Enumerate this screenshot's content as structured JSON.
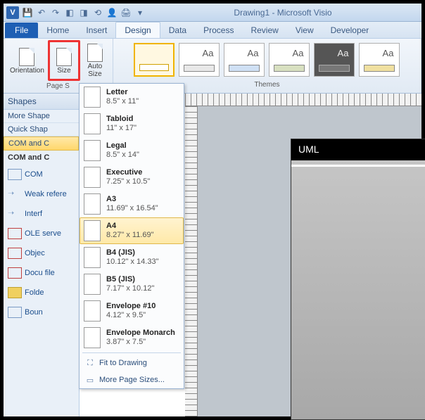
{
  "title": "Drawing1  - Microsoft Visio",
  "tabs": {
    "file": "File",
    "home": "Home",
    "insert": "Insert",
    "design": "Design",
    "data": "Data",
    "process": "Process",
    "review": "Review",
    "view": "View",
    "developer": "Developer"
  },
  "ribbon": {
    "orientation": "Orientation",
    "size": "Size",
    "autosize": "Auto\nSize",
    "page_setup": "Page S",
    "themes": "Themes",
    "theme_swatches": [
      "",
      "Aa",
      "Aa",
      "Aa",
      "Aa",
      "Aa"
    ]
  },
  "size_menu": {
    "items": [
      {
        "name": "Letter",
        "dim": "8.5\" x 11\""
      },
      {
        "name": "Tabloid",
        "dim": "11\" x 17\""
      },
      {
        "name": "Legal",
        "dim": "8.5\" x 14\""
      },
      {
        "name": "Executive",
        "dim": "7.25\" x 10.5\""
      },
      {
        "name": "A3",
        "dim": "11.69\" x 16.54\""
      },
      {
        "name": "A4",
        "dim": "8.27\" x 11.69\""
      },
      {
        "name": "B4 (JIS)",
        "dim": "10.12\" x 14.33\""
      },
      {
        "name": "B5 (JIS)",
        "dim": "7.17\" x 10.12\""
      },
      {
        "name": "Envelope #10",
        "dim": "4.12\" x 9.5\""
      },
      {
        "name": "Envelope Monarch",
        "dim": "3.87\" x 7.5\""
      }
    ],
    "selected_index": 5,
    "fit": "Fit to Drawing",
    "more": "More Page Sizes..."
  },
  "shapes": {
    "header": "Shapes",
    "more": "More Shape",
    "quick": "Quick Shap",
    "gold": "COM and C",
    "cat": "COM and C",
    "items": [
      "COM",
      "Weak refere",
      "Interf",
      "OLE serve",
      "Objec",
      "Docu file",
      "Folde",
      "Boun"
    ]
  },
  "canvas": {
    "uml": "UML"
  }
}
